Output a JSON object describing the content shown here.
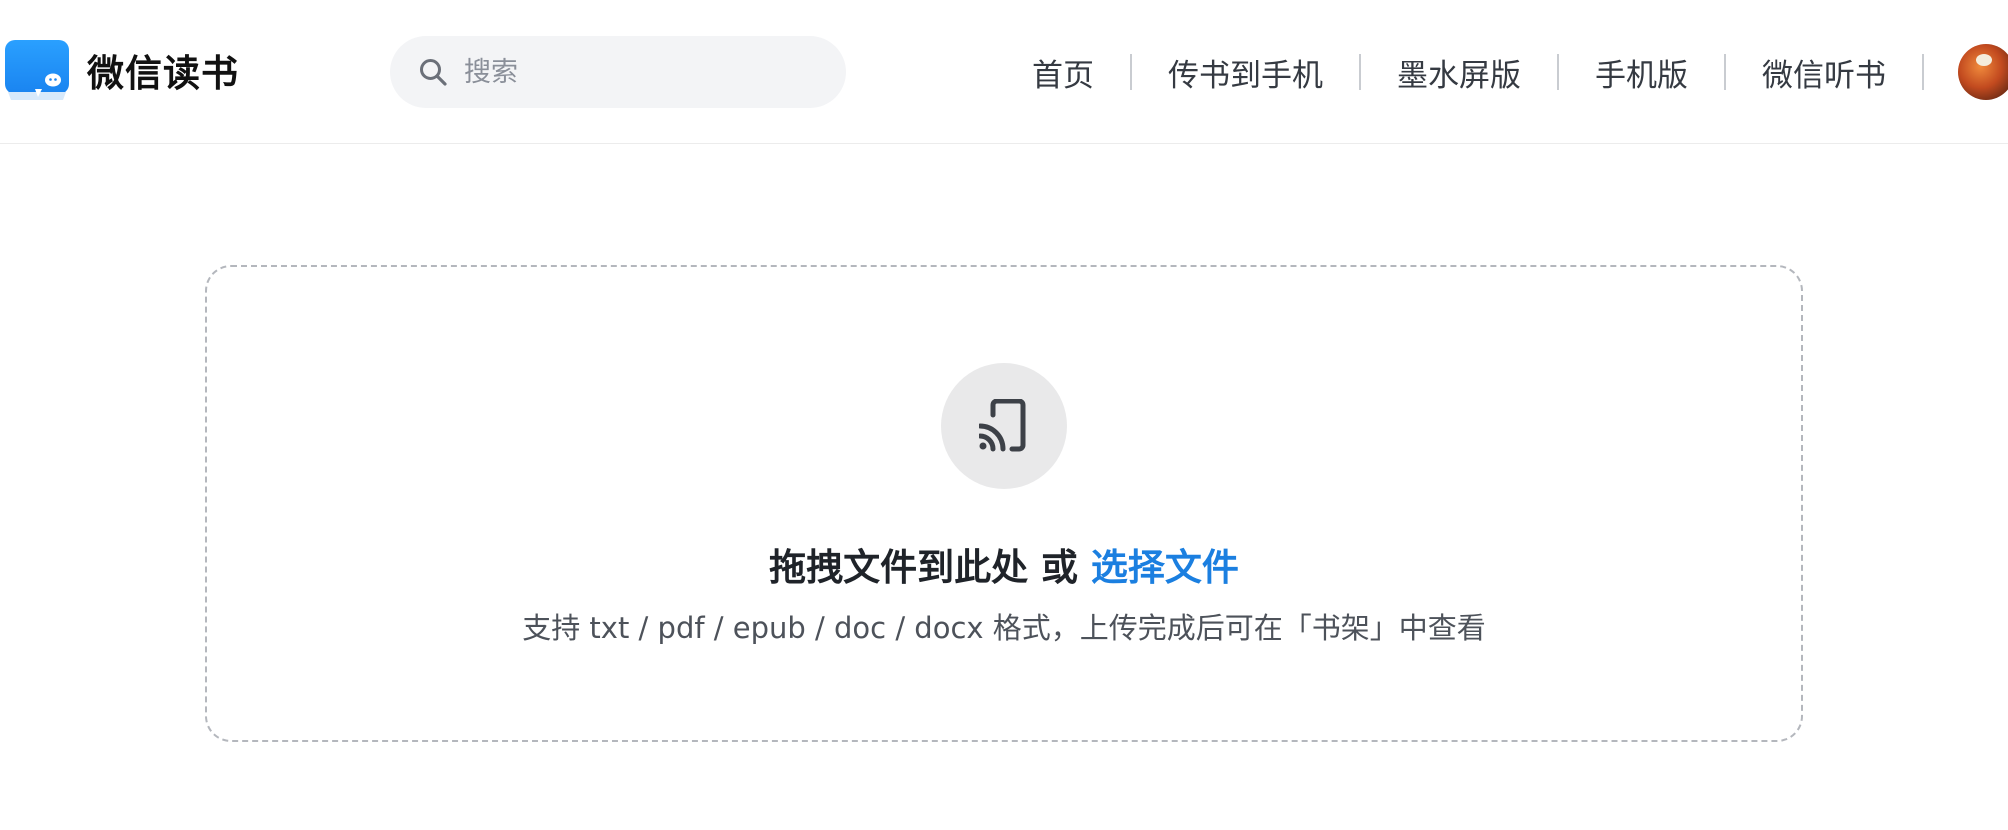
{
  "header": {
    "logo_text": "微信读书",
    "search_placeholder": "搜索",
    "nav": [
      {
        "label": "首页"
      },
      {
        "label": "传书到手机"
      },
      {
        "label": "墨水屏版"
      },
      {
        "label": "手机版"
      },
      {
        "label": "微信听书"
      }
    ]
  },
  "upload": {
    "title": "拖拽文件到此处 或",
    "choose_label": "选择文件",
    "hint": "支持 txt / pdf / epub / doc / docx 格式，上传完成后可在「书架」中查看"
  },
  "colors": {
    "brand_blue": "#1E90FF",
    "link_blue": "#1B7FE0"
  },
  "icons": {
    "search": "search-icon",
    "upload": "cast-to-phone-icon"
  }
}
